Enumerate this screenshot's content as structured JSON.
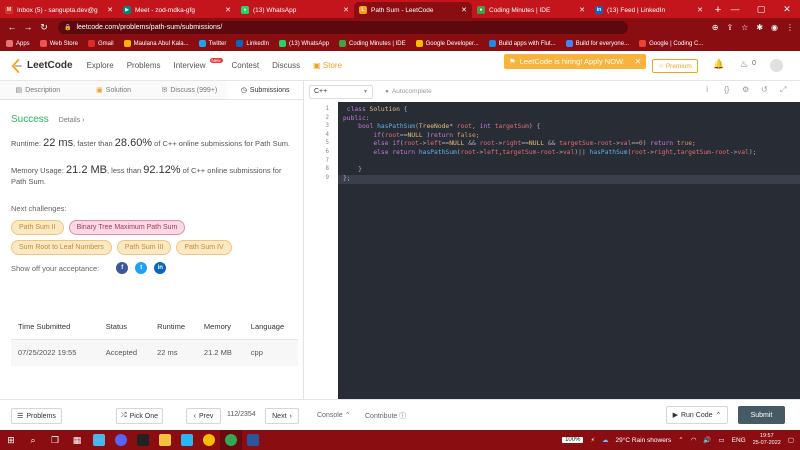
{
  "browser": {
    "tabs": [
      {
        "title": "Inbox (5) - sangupta.dev@g",
        "color": "#d93025",
        "glyph": "M"
      },
      {
        "title": "Meet - zod-mdka-gfg",
        "color": "#00897b",
        "glyph": "▶"
      },
      {
        "title": "(13) WhatsApp",
        "color": "#25d366",
        "glyph": "●"
      },
      {
        "title": "Path Sum - LeetCode",
        "color": "#f89f1b",
        "glyph": "L"
      },
      {
        "title": "Coding Minutes | IDE",
        "color": "#43a047",
        "glyph": "●"
      },
      {
        "title": "(13) Feed | LinkedIn",
        "color": "#0a66c2",
        "glyph": "in"
      }
    ],
    "address": "leetcode.com/problems/path-sum/submissions/",
    "bookmarks": [
      {
        "label": "Apps",
        "color": "#e57373"
      },
      {
        "label": "Web Store",
        "color": "#ef5350"
      },
      {
        "label": "Gmail",
        "color": "#d93025"
      },
      {
        "label": "Maulana Abul Kala...",
        "color": "#ffb300"
      },
      {
        "label": "Twitter",
        "color": "#1da1f2"
      },
      {
        "label": "LinkedIn",
        "color": "#0a66c2"
      },
      {
        "label": "(13) WhatsApp",
        "color": "#25d366"
      },
      {
        "label": "Coding Minutes | IDE",
        "color": "#43a047"
      },
      {
        "label": "Google Developer...",
        "color": "#fbbc04"
      },
      {
        "label": "Build apps with Flut...",
        "color": "#1e88e5"
      },
      {
        "label": "Build for everyone...",
        "color": "#4285f4"
      },
      {
        "label": "Google | Coding C...",
        "color": "#ea4335"
      }
    ]
  },
  "nav": {
    "logo": "LeetCode",
    "links": [
      "Explore",
      "Problems",
      "Interview",
      "Contest",
      "Discuss",
      "Store"
    ],
    "new_badge": "New",
    "hiring": "LeetCode is hiring! Apply NOW.",
    "premium": "Premium",
    "fire_count": "0"
  },
  "left_tabs": [
    {
      "label": "Description",
      "icon": "file-icon"
    },
    {
      "label": "Solution",
      "icon": "lock-icon"
    },
    {
      "label": "Discuss (999+)",
      "icon": "chat-icon"
    },
    {
      "label": "Submissions",
      "icon": "clock-icon"
    }
  ],
  "result": {
    "status": "Success",
    "details": "Details",
    "runtime_pre": "Runtime: ",
    "runtime_val": "22 ms",
    "runtime_mid": ", faster than ",
    "runtime_pct": "28.60%",
    "runtime_post": " of C++ online submissions for Path Sum.",
    "mem_pre": "Memory Usage: ",
    "mem_val": "21.2 MB",
    "mem_mid": ", less than ",
    "mem_pct": "92.12%",
    "mem_post": " of C++ online submissions for Path Sum."
  },
  "next": {
    "label": "Next challenges:",
    "items": [
      {
        "label": "Path Sum II",
        "level": "easy"
      },
      {
        "label": "Binary Tree Maximum Path Sum",
        "level": "hard"
      },
      {
        "label": "Sum Root to Leaf Numbers",
        "level": "easy"
      },
      {
        "label": "Path Sum III",
        "level": "easy"
      },
      {
        "label": "Path Sum IV",
        "level": "easy"
      }
    ]
  },
  "share_label": "Show off your acceptance:",
  "table": {
    "headers": [
      "Time Submitted",
      "Status",
      "Runtime",
      "Memory",
      "Language"
    ],
    "row": [
      "07/25/2022 19:55",
      "Accepted",
      "22 ms",
      "21.2 MB",
      "cpp"
    ]
  },
  "editor": {
    "language": "C++",
    "autocomplete": "Autocomplete",
    "lines": [
      "1",
      "2",
      "3",
      "4",
      "5",
      "6",
      "7",
      "8",
      "9"
    ]
  },
  "bottom": {
    "problems": "Problems",
    "pick_one": "Pick One",
    "prev": "Prev",
    "page": "112/2354",
    "next": "Next",
    "console": "Console",
    "contribute": "Contribute",
    "run_code": "Run Code",
    "submit": "Submit"
  },
  "taskbar": {
    "battery": "100%",
    "weather": "29°C  Rain showers",
    "lang": "ENG",
    "time": "19:57",
    "date": "25-07-2022"
  }
}
